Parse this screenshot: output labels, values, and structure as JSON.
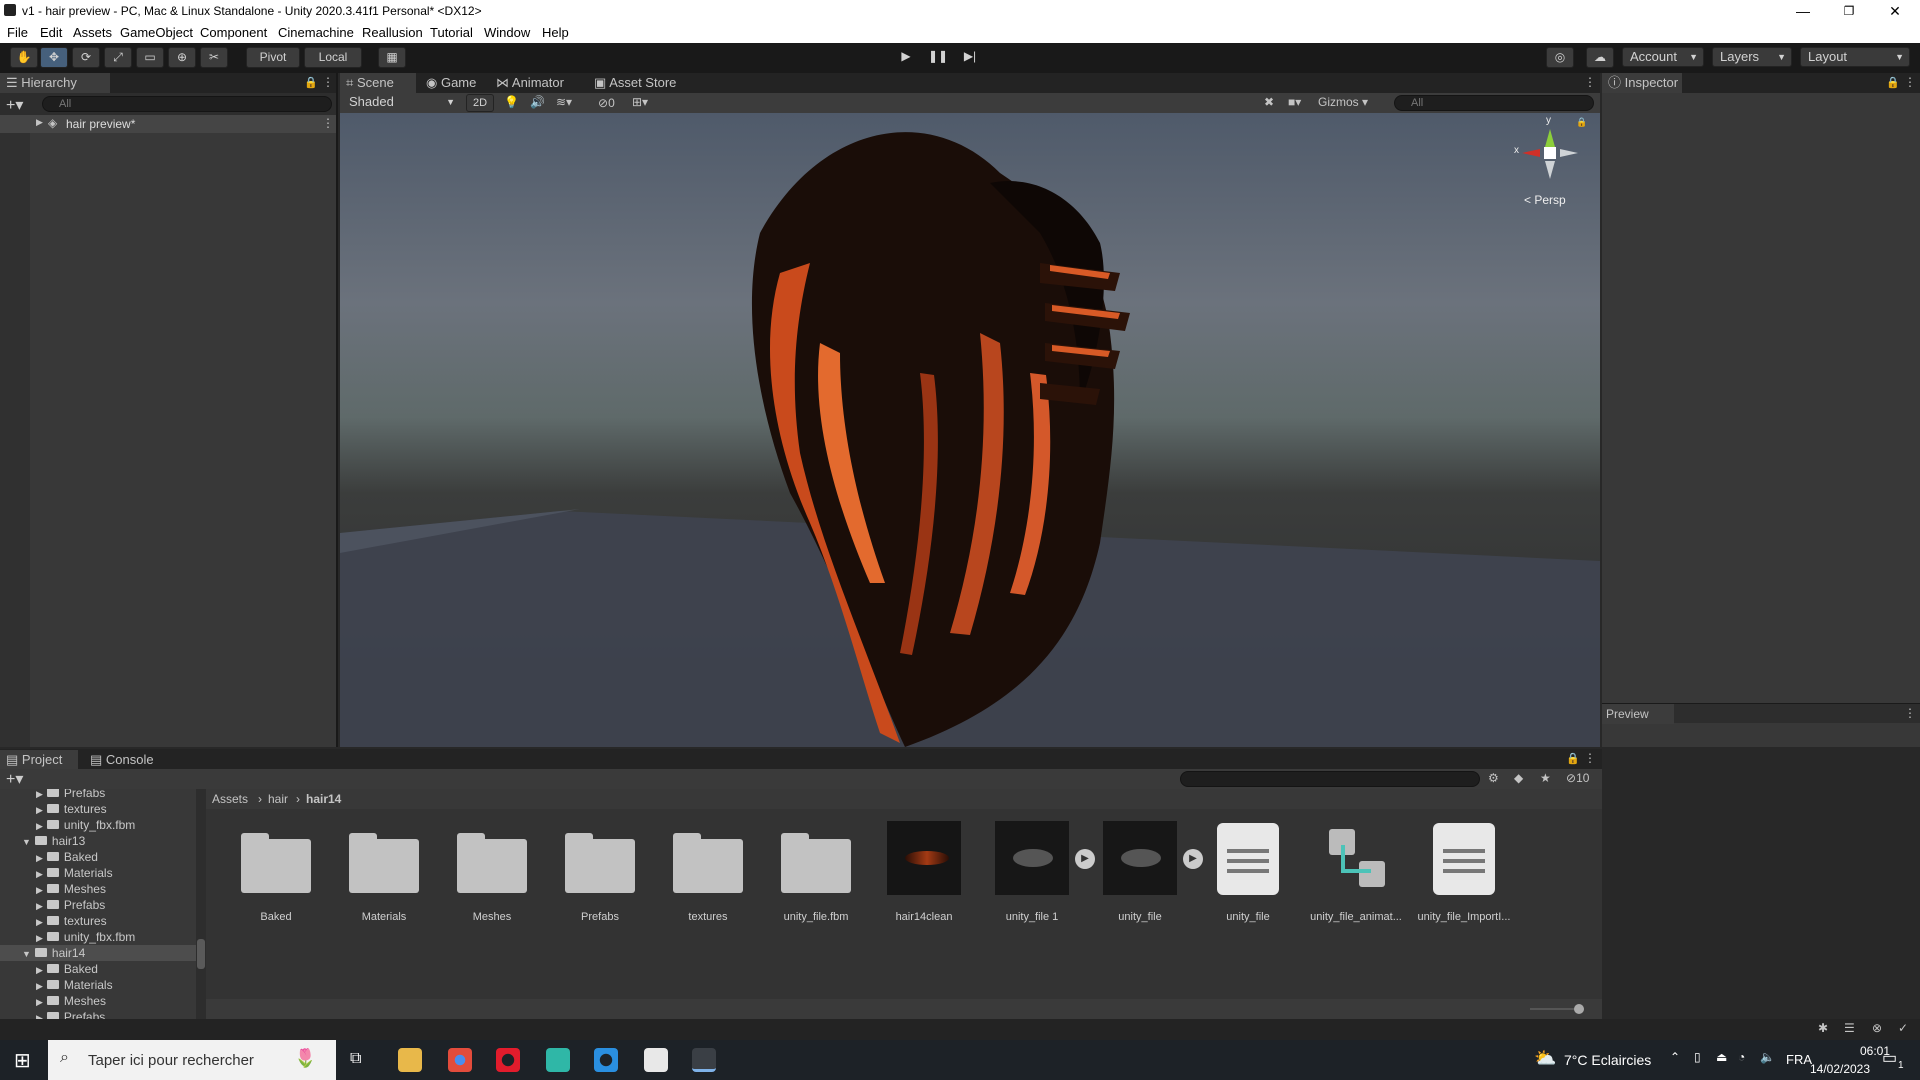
{
  "window": {
    "title": "v1 - hair preview - PC, Mac & Linux Standalone - Unity 2020.3.41f1 Personal* <DX12>"
  },
  "menu": [
    "File",
    "Edit",
    "Assets",
    "GameObject",
    "Component",
    "Cinemachine",
    "Reallusion",
    "Tutorial",
    "Window",
    "Help"
  ],
  "toolbar": {
    "pivot": "Pivot",
    "local": "Local",
    "account": "Account",
    "layers": "Layers",
    "layout": "Layout"
  },
  "hierarchy": {
    "title": "Hierarchy",
    "search_placeholder": "All",
    "root_item": "hair preview*"
  },
  "scene": {
    "tabs": [
      "Scene",
      "Game",
      "Animator",
      "Asset Store"
    ],
    "shading": "Shaded",
    "mode2d": "2D",
    "hidden_count": "0",
    "gizmos": "Gizmos",
    "search_placeholder": "All",
    "persp": "< Persp",
    "axis_y": "y",
    "axis_x": "x"
  },
  "inspector": {
    "title": "Inspector",
    "preview": "Preview"
  },
  "project": {
    "tabs": [
      "Project",
      "Console"
    ],
    "hidden_count": "10",
    "breadcrumb": [
      "Assets",
      "hair",
      "hair14"
    ],
    "tree": [
      {
        "label": "Prefabs",
        "indent": 3,
        "folder": true
      },
      {
        "label": "textures",
        "indent": 3,
        "folder": true
      },
      {
        "label": "unity_fbx.fbm",
        "indent": 3,
        "folder": true
      },
      {
        "label": "hair13",
        "indent": 2,
        "folder": true,
        "open": true
      },
      {
        "label": "Baked",
        "indent": 3,
        "folder": true
      },
      {
        "label": "Materials",
        "indent": 3,
        "folder": true
      },
      {
        "label": "Meshes",
        "indent": 3,
        "folder": true
      },
      {
        "label": "Prefabs",
        "indent": 3,
        "folder": true
      },
      {
        "label": "textures",
        "indent": 3,
        "folder": true
      },
      {
        "label": "unity_fbx.fbm",
        "indent": 3,
        "folder": true
      },
      {
        "label": "hair14",
        "indent": 2,
        "folder": true,
        "open": true,
        "selected": true
      },
      {
        "label": "Baked",
        "indent": 3,
        "folder": true
      },
      {
        "label": "Materials",
        "indent": 3,
        "folder": true
      },
      {
        "label": "Meshes",
        "indent": 3,
        "folder": true
      },
      {
        "label": "Prefabs",
        "indent": 3,
        "folder": true
      }
    ],
    "assets": [
      {
        "label": "Baked",
        "kind": "folder"
      },
      {
        "label": "Materials",
        "kind": "folder"
      },
      {
        "label": "Meshes",
        "kind": "folder"
      },
      {
        "label": "Prefabs",
        "kind": "folder"
      },
      {
        "label": "textures",
        "kind": "folder"
      },
      {
        "label": "unity_file.fbm",
        "kind": "folder"
      },
      {
        "label": "hair14clean",
        "kind": "material"
      },
      {
        "label": "unity_file 1",
        "kind": "model"
      },
      {
        "label": "unity_file",
        "kind": "model"
      },
      {
        "label": "unity_file",
        "kind": "doc"
      },
      {
        "label": "unity_file_animat...",
        "kind": "anim"
      },
      {
        "label": "unity_file_ImportI...",
        "kind": "doc"
      }
    ]
  },
  "taskbar": {
    "search_placeholder": "Taper ici pour rechercher",
    "weather": "7°C  Eclaircies",
    "lang": "FRA",
    "time": "06:01",
    "date": "14/02/2023",
    "notif": "1"
  }
}
